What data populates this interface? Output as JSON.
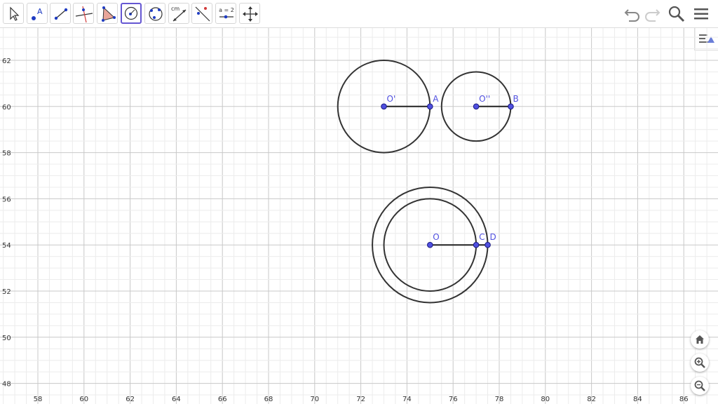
{
  "toolbar": {
    "tools": [
      {
        "name": "move-tool",
        "icon": "arrow-cursor-icon"
      },
      {
        "name": "point-tool",
        "icon": "point-icon",
        "label": "A"
      },
      {
        "name": "line-tool",
        "icon": "line-icon"
      },
      {
        "name": "perpendicular-line-tool",
        "icon": "perpendicular-line-icon"
      },
      {
        "name": "polygon-tool",
        "icon": "polygon-icon"
      },
      {
        "name": "circle-center-point-tool",
        "icon": "circle-center-point-icon",
        "active": true
      },
      {
        "name": "circle-three-points-tool",
        "icon": "circle-three-points-icon"
      },
      {
        "name": "distance-tool",
        "icon": "distance-icon",
        "label": "cm"
      },
      {
        "name": "reflect-tool",
        "icon": "reflect-icon"
      },
      {
        "name": "slider-tool",
        "icon": "slider-icon",
        "label": "a = 2"
      },
      {
        "name": "move-graphics-view-tool",
        "icon": "move-graphics-view-icon"
      }
    ],
    "right": [
      "undo-icon",
      "redo-icon",
      "search-icon",
      "menu-icon"
    ]
  },
  "side_controls": [
    "algebra-view-toggle-icon",
    "home-icon",
    "zoom-in-icon",
    "zoom-out-icon"
  ],
  "graph": {
    "x_ticks": [
      "58",
      "60",
      "62",
      "64",
      "66",
      "68",
      "70",
      "72",
      "74",
      "76",
      "78",
      "80",
      "82",
      "84",
      "86"
    ],
    "y_ticks": [
      "62",
      "60",
      "58",
      "56",
      "54",
      "52",
      "50",
      "48"
    ],
    "point_color": "#5050e0",
    "line_color": "#333333",
    "points": [
      {
        "label": "O'",
        "x": 73,
        "y": 60
      },
      {
        "label": "A",
        "x": 75,
        "y": 60
      },
      {
        "label": "O''",
        "x": 77,
        "y": 60
      },
      {
        "label": "B",
        "x": 78.5,
        "y": 60
      },
      {
        "label": "O",
        "x": 75,
        "y": 54
      },
      {
        "label": "C",
        "x": 77,
        "y": 54
      },
      {
        "label": "D",
        "x": 77.5,
        "y": 54
      }
    ],
    "circles": [
      {
        "center": "O'",
        "radius": 2
      },
      {
        "center": "O''",
        "radius": 1.5
      },
      {
        "center": "O",
        "radius": 2
      },
      {
        "center": "O",
        "radius": 2.5
      }
    ],
    "segments": [
      [
        "O'",
        "A"
      ],
      [
        "O''",
        "B"
      ],
      [
        "O",
        "C"
      ],
      [
        "C",
        "D"
      ]
    ]
  }
}
